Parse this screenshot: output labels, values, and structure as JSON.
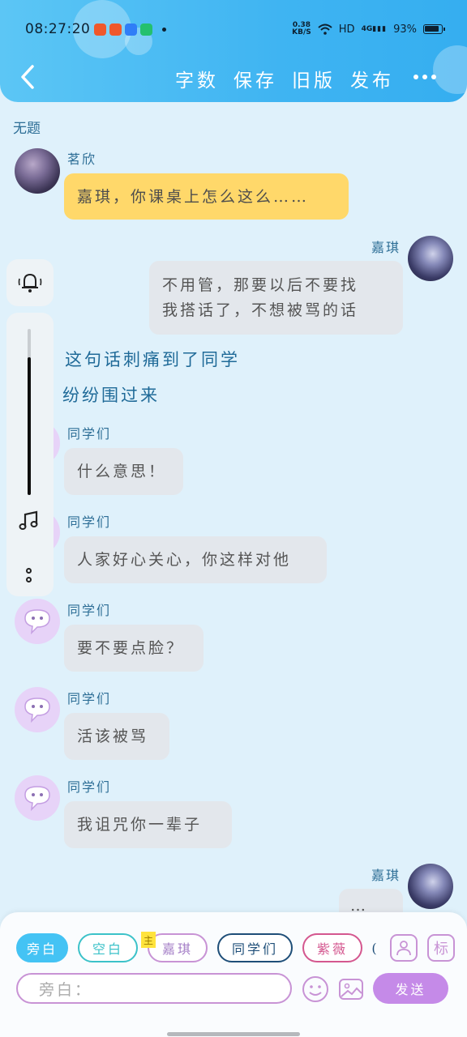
{
  "status_bar": {
    "time": "08:27:20",
    "net_speed_top": "0.38",
    "net_speed_bottom": "KB/S",
    "hd": "HD",
    "signal": "4G",
    "battery": "93%"
  },
  "header": {
    "actions": [
      "字数",
      "保存",
      "旧版",
      "发布"
    ]
  },
  "page_title": "无题",
  "messages": [
    {
      "sender": "茗欣",
      "text": "嘉琪，你课桌上怎么这么……"
    },
    {
      "sender": "嘉琪",
      "line1": "不用管，那要以后不要找",
      "line2": "我搭话了，不想被骂的话"
    },
    {
      "narration1": "这句话刺痛到了同学",
      "narration2": "纷纷围过来"
    },
    {
      "sender": "同学们",
      "text": "什么意思！"
    },
    {
      "sender": "同学们",
      "text": "人家好心关心，你这样对他"
    },
    {
      "sender": "同学们",
      "text": "要不要点脸？"
    },
    {
      "sender": "同学们",
      "text": "活该被骂"
    },
    {
      "sender": "同学们",
      "text": "我诅咒你一辈子"
    },
    {
      "sender": "嘉琪",
      "text": "…"
    }
  ],
  "composer": {
    "chips": [
      "旁白",
      "空白",
      "嘉琪",
      "同学们",
      "紫薇",
      "("
    ],
    "host_tag": "主",
    "mark_label": "标",
    "input_placeholder": "旁白：",
    "send_label": "发送"
  },
  "colors": {
    "header": "#3fb4f2",
    "accent_purple": "#c58ae8",
    "bubble_yellow": "#ffd86a",
    "bubble_gray": "#e3e7ec"
  }
}
